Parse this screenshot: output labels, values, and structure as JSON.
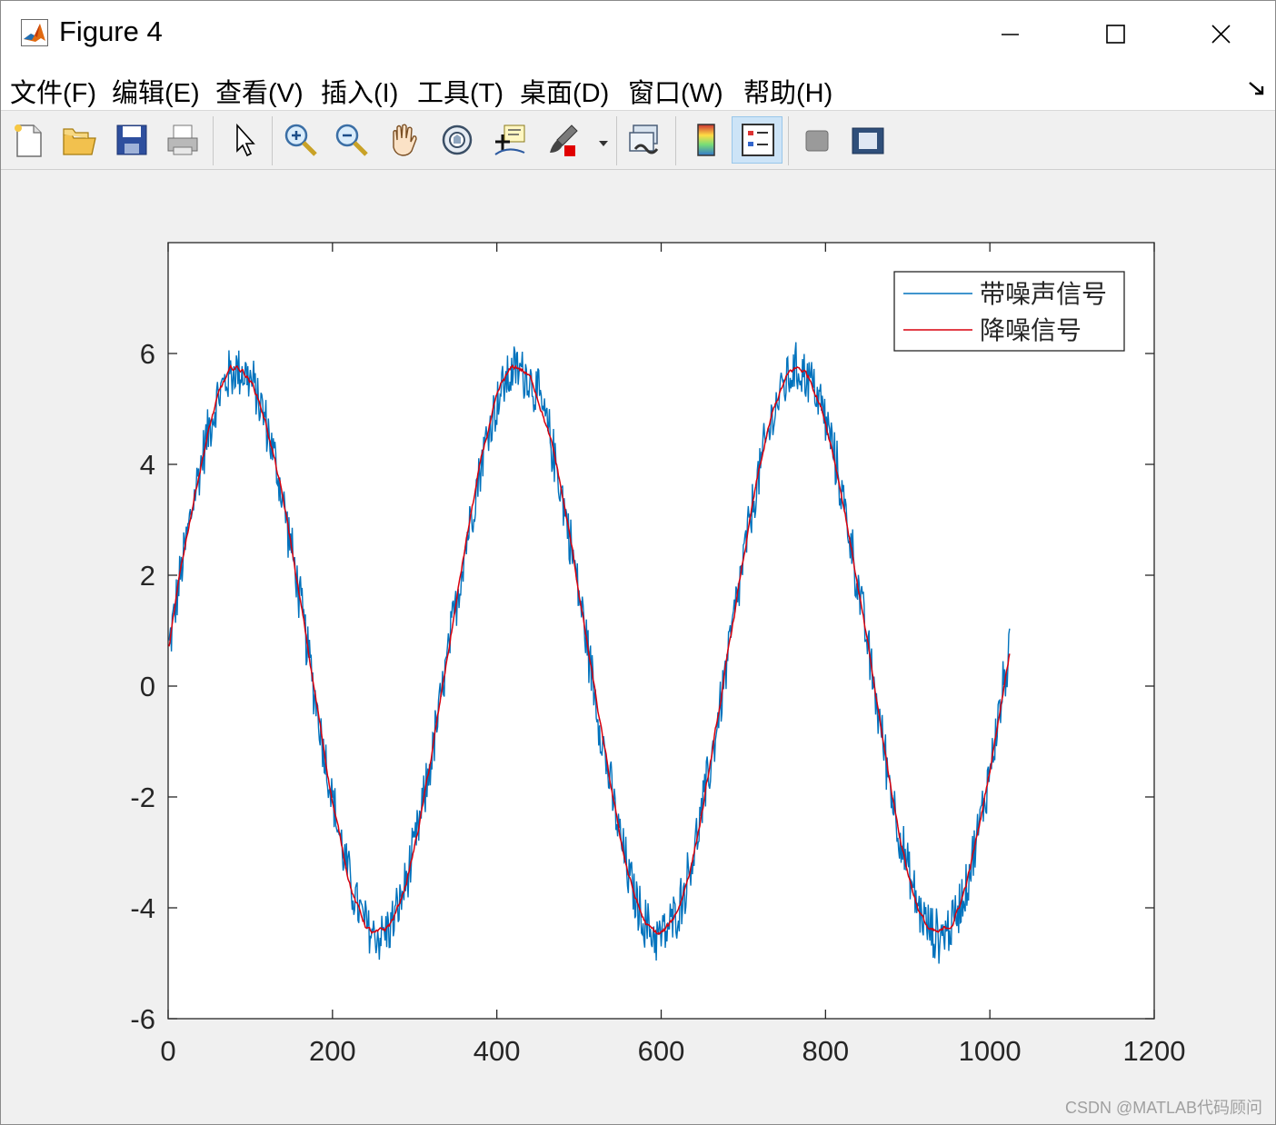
{
  "window": {
    "title": "Figure 4",
    "icon": "matlab-logo-icon",
    "controls": [
      "minimize-icon",
      "maximize-icon",
      "close-icon"
    ]
  },
  "menu": {
    "items": [
      "文件(F)",
      "编辑(E)",
      "查看(V)",
      "插入(I)",
      "工具(T)",
      "桌面(D)",
      "窗口(W)",
      "帮助(H)"
    ],
    "dock_icon": "dock-arrow-icon"
  },
  "toolbar": {
    "buttons": [
      {
        "icon": "new-figure-icon"
      },
      {
        "icon": "open-folder-icon"
      },
      {
        "icon": "save-icon"
      },
      {
        "icon": "print-icon"
      },
      {
        "icon": "pointer-icon"
      },
      {
        "icon": "zoom-in-icon"
      },
      {
        "icon": "zoom-out-icon"
      },
      {
        "icon": "pan-hand-icon"
      },
      {
        "icon": "rotate-3d-icon"
      },
      {
        "icon": "data-cursor-icon"
      },
      {
        "icon": "brush-icon"
      },
      {
        "icon": "link-plot-icon"
      },
      {
        "icon": "colorbar-icon"
      },
      {
        "icon": "legend-icon",
        "active": true
      },
      {
        "icon": "hide-plot-tools-icon"
      },
      {
        "icon": "show-plot-tools-icon"
      }
    ]
  },
  "chart_data": {
    "type": "line",
    "title": "",
    "xlabel": "",
    "ylabel": "",
    "xlim": [
      0,
      1200
    ],
    "ylim": [
      -6,
      8
    ],
    "xticks": [
      0,
      200,
      400,
      600,
      800,
      1000,
      1200
    ],
    "yticks": [
      -6,
      -4,
      -2,
      0,
      2,
      4,
      6
    ],
    "grid": false,
    "legend_position": "top-right",
    "model": {
      "offset": 0.6,
      "amplitude": 5.1,
      "period": 341,
      "phase": 0
    },
    "series": [
      {
        "name": "带噪声信号",
        "color": "#0072bd",
        "x_range": [
          1,
          1024
        ],
        "noise_amplitude": 0.35,
        "description_values_at": {
          "x": [
            0,
            85,
            170,
            255,
            340,
            426,
            511,
            596,
            682,
            767,
            852,
            937,
            1023
          ],
          "y": [
            0.2,
            5.7,
            0.6,
            -4.5,
            0.4,
            5.6,
            0.6,
            -4.4,
            0.7,
            5.7,
            0.6,
            -4.5,
            0.6
          ]
        }
      },
      {
        "name": "降噪信号",
        "color": "#d9000d",
        "x_range": [
          1,
          1024
        ],
        "noise_amplitude": 0.08,
        "description_values_at": {
          "x": [
            0,
            85,
            170,
            255,
            340,
            426,
            511,
            596,
            682,
            767,
            852,
            937,
            1023
          ],
          "y": [
            0.3,
            5.6,
            0.6,
            -4.5,
            0.5,
            5.6,
            0.6,
            -4.4,
            0.7,
            5.6,
            0.6,
            -4.5,
            0.4
          ]
        }
      }
    ]
  },
  "watermark": "CSDN @MATLAB代码顾问"
}
